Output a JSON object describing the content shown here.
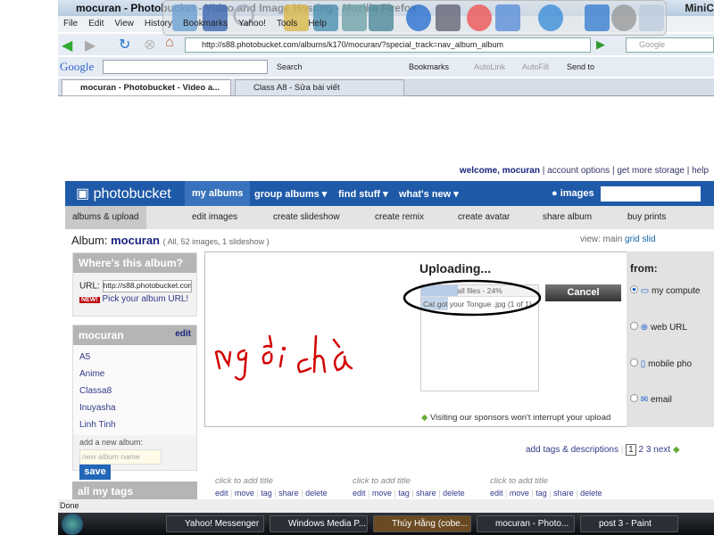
{
  "window": {
    "title": "mocuran - Photobucket - Video and Image Hosting - Mozilla Firefox",
    "right_title": "MiniC"
  },
  "menu": [
    "File",
    "Edit",
    "View",
    "History",
    "Bookmarks",
    "Yahoo!",
    "Tools",
    "Help"
  ],
  "nav": {
    "url": "http://s88.photobucket.com/albums/k170/mocuran/?special_track=nav_album_album",
    "search_placeholder": "Google"
  },
  "google_bar": {
    "logo": "Google",
    "search": "Search",
    "bookmarks": "Bookmarks",
    "autolink": "AutoLink",
    "autofill": "AutoFill",
    "sendto": "Send to"
  },
  "tabs": [
    {
      "label": "mocuran - Photobucket - Video a..."
    },
    {
      "label": "Class A8 - Sửa bài viết"
    }
  ],
  "header": {
    "welcome": "welcome, mocuran",
    "links": [
      "account options",
      "get more storage",
      "help"
    ]
  },
  "pb_nav": {
    "logo": "photobucket",
    "items": [
      "my albums",
      "group albums ▾",
      "find stuff ▾",
      "what's new ▾"
    ],
    "search_label": "images"
  },
  "sub_nav": [
    "albums & upload",
    "edit images",
    "create slideshow",
    "create remix",
    "create avatar",
    "share album",
    "buy prints"
  ],
  "album": {
    "label": "Album:",
    "name": "mocuran",
    "meta": "( All, 52 images, 1 slideshow )",
    "view_label": "view:",
    "views": [
      "main",
      "grid",
      "slid"
    ]
  },
  "where": {
    "title": "Where's this album?",
    "url_label": "URL:",
    "url_value": "http://s88.photobucket.com",
    "new_badge": "NEW!",
    "pick_link": "Pick your album URL!"
  },
  "albums_box": {
    "title": "mocuran",
    "edit": "edit",
    "items": [
      "A5",
      "Anime",
      "Classa8",
      "Inuyasha",
      "Linh Tinh"
    ],
    "add_label": "add a new album:",
    "input_placeholder": "new album name",
    "save": "save"
  },
  "tags_box": {
    "title": "all my tags"
  },
  "upload": {
    "title": "Uploading...",
    "all_files": "all files - 24%",
    "progress_percent": 24,
    "file": "Cat got your Tongue .jpg (1 of 1)",
    "cancel": "Cancel",
    "sponsor_note": "Visiting our sponsors won't interrupt your upload"
  },
  "from": {
    "title": "from:",
    "options": [
      "my compute",
      "web URL",
      "mobile pho",
      "email"
    ],
    "selected": 0
  },
  "pagination": {
    "add_tags": "add tags & descriptions",
    "pages": [
      "1",
      "2",
      "3"
    ],
    "current": "1",
    "next": "next"
  },
  "thumbs": [
    {
      "title": "click to add title",
      "actions": [
        "edit",
        "move",
        "tag",
        "share",
        "delete"
      ]
    },
    {
      "title": "click to add title",
      "actions": [
        "edit",
        "move",
        "tag",
        "share",
        "delete"
      ]
    },
    {
      "title": "click to add title",
      "actions": [
        "edit",
        "move",
        "tag",
        "share",
        "delete"
      ]
    }
  ],
  "status": "Done",
  "taskbar": [
    "Yahoo! Messenger",
    "Windows Media P...",
    "Thúy Hằng (cobe...",
    "mocuran - Photo...",
    "post 3 - Paint"
  ],
  "colors": {
    "pb_blue": "#1f5aa8",
    "link": "#333a8a",
    "annotation_red": "#d40000"
  }
}
